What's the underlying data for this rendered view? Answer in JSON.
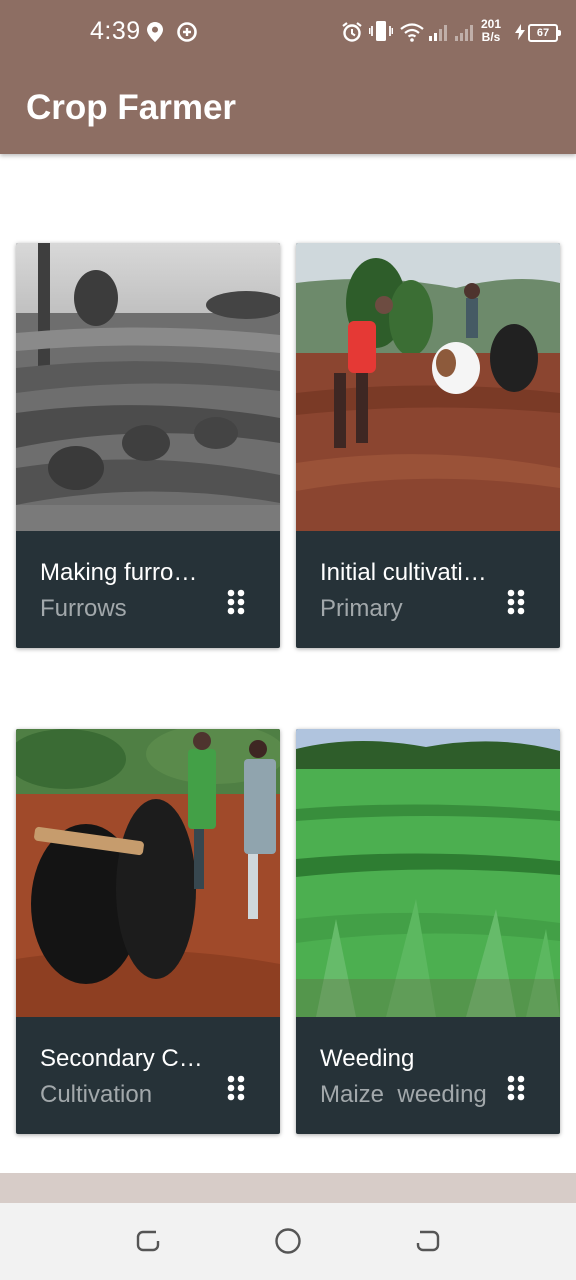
{
  "status_bar": {
    "time": "4:39",
    "net_speed_value": "201",
    "net_speed_unit": "B/s",
    "battery": "67",
    "icons": [
      "location-icon",
      "data-saver-icon",
      "alarm-icon",
      "vibrate-icon",
      "wifi-icon",
      "signal-icon",
      "signal-icon",
      "charging-icon"
    ]
  },
  "app_bar": {
    "title": "Crop Farmer"
  },
  "cards": [
    {
      "title": "Making furro…",
      "subtitle": "Furrows",
      "image": "black-and-white photo of a field with furrow ridges"
    },
    {
      "title": "Initial cultivati…",
      "subtitle": "Primary",
      "image": "farmer ploughing red soil with oxen"
    },
    {
      "title": "Secondary Cu…",
      "subtitle": "Cultivation",
      "image": "two men working with yoked black oxen"
    },
    {
      "title": "Weeding",
      "subtitle": "Maize  weeding",
      "image": "rows of young maize plants"
    }
  ],
  "nav_bar": {
    "icons": [
      "recent-apps-icon",
      "home-icon",
      "back-icon"
    ]
  },
  "colors": {
    "app_bar": "#8d6e63",
    "card_footer": "#263238",
    "subtitle_text": "#a2a8ab",
    "bottom_strip": "#d7ccc8",
    "nav_bar": "#f2f2f2"
  }
}
